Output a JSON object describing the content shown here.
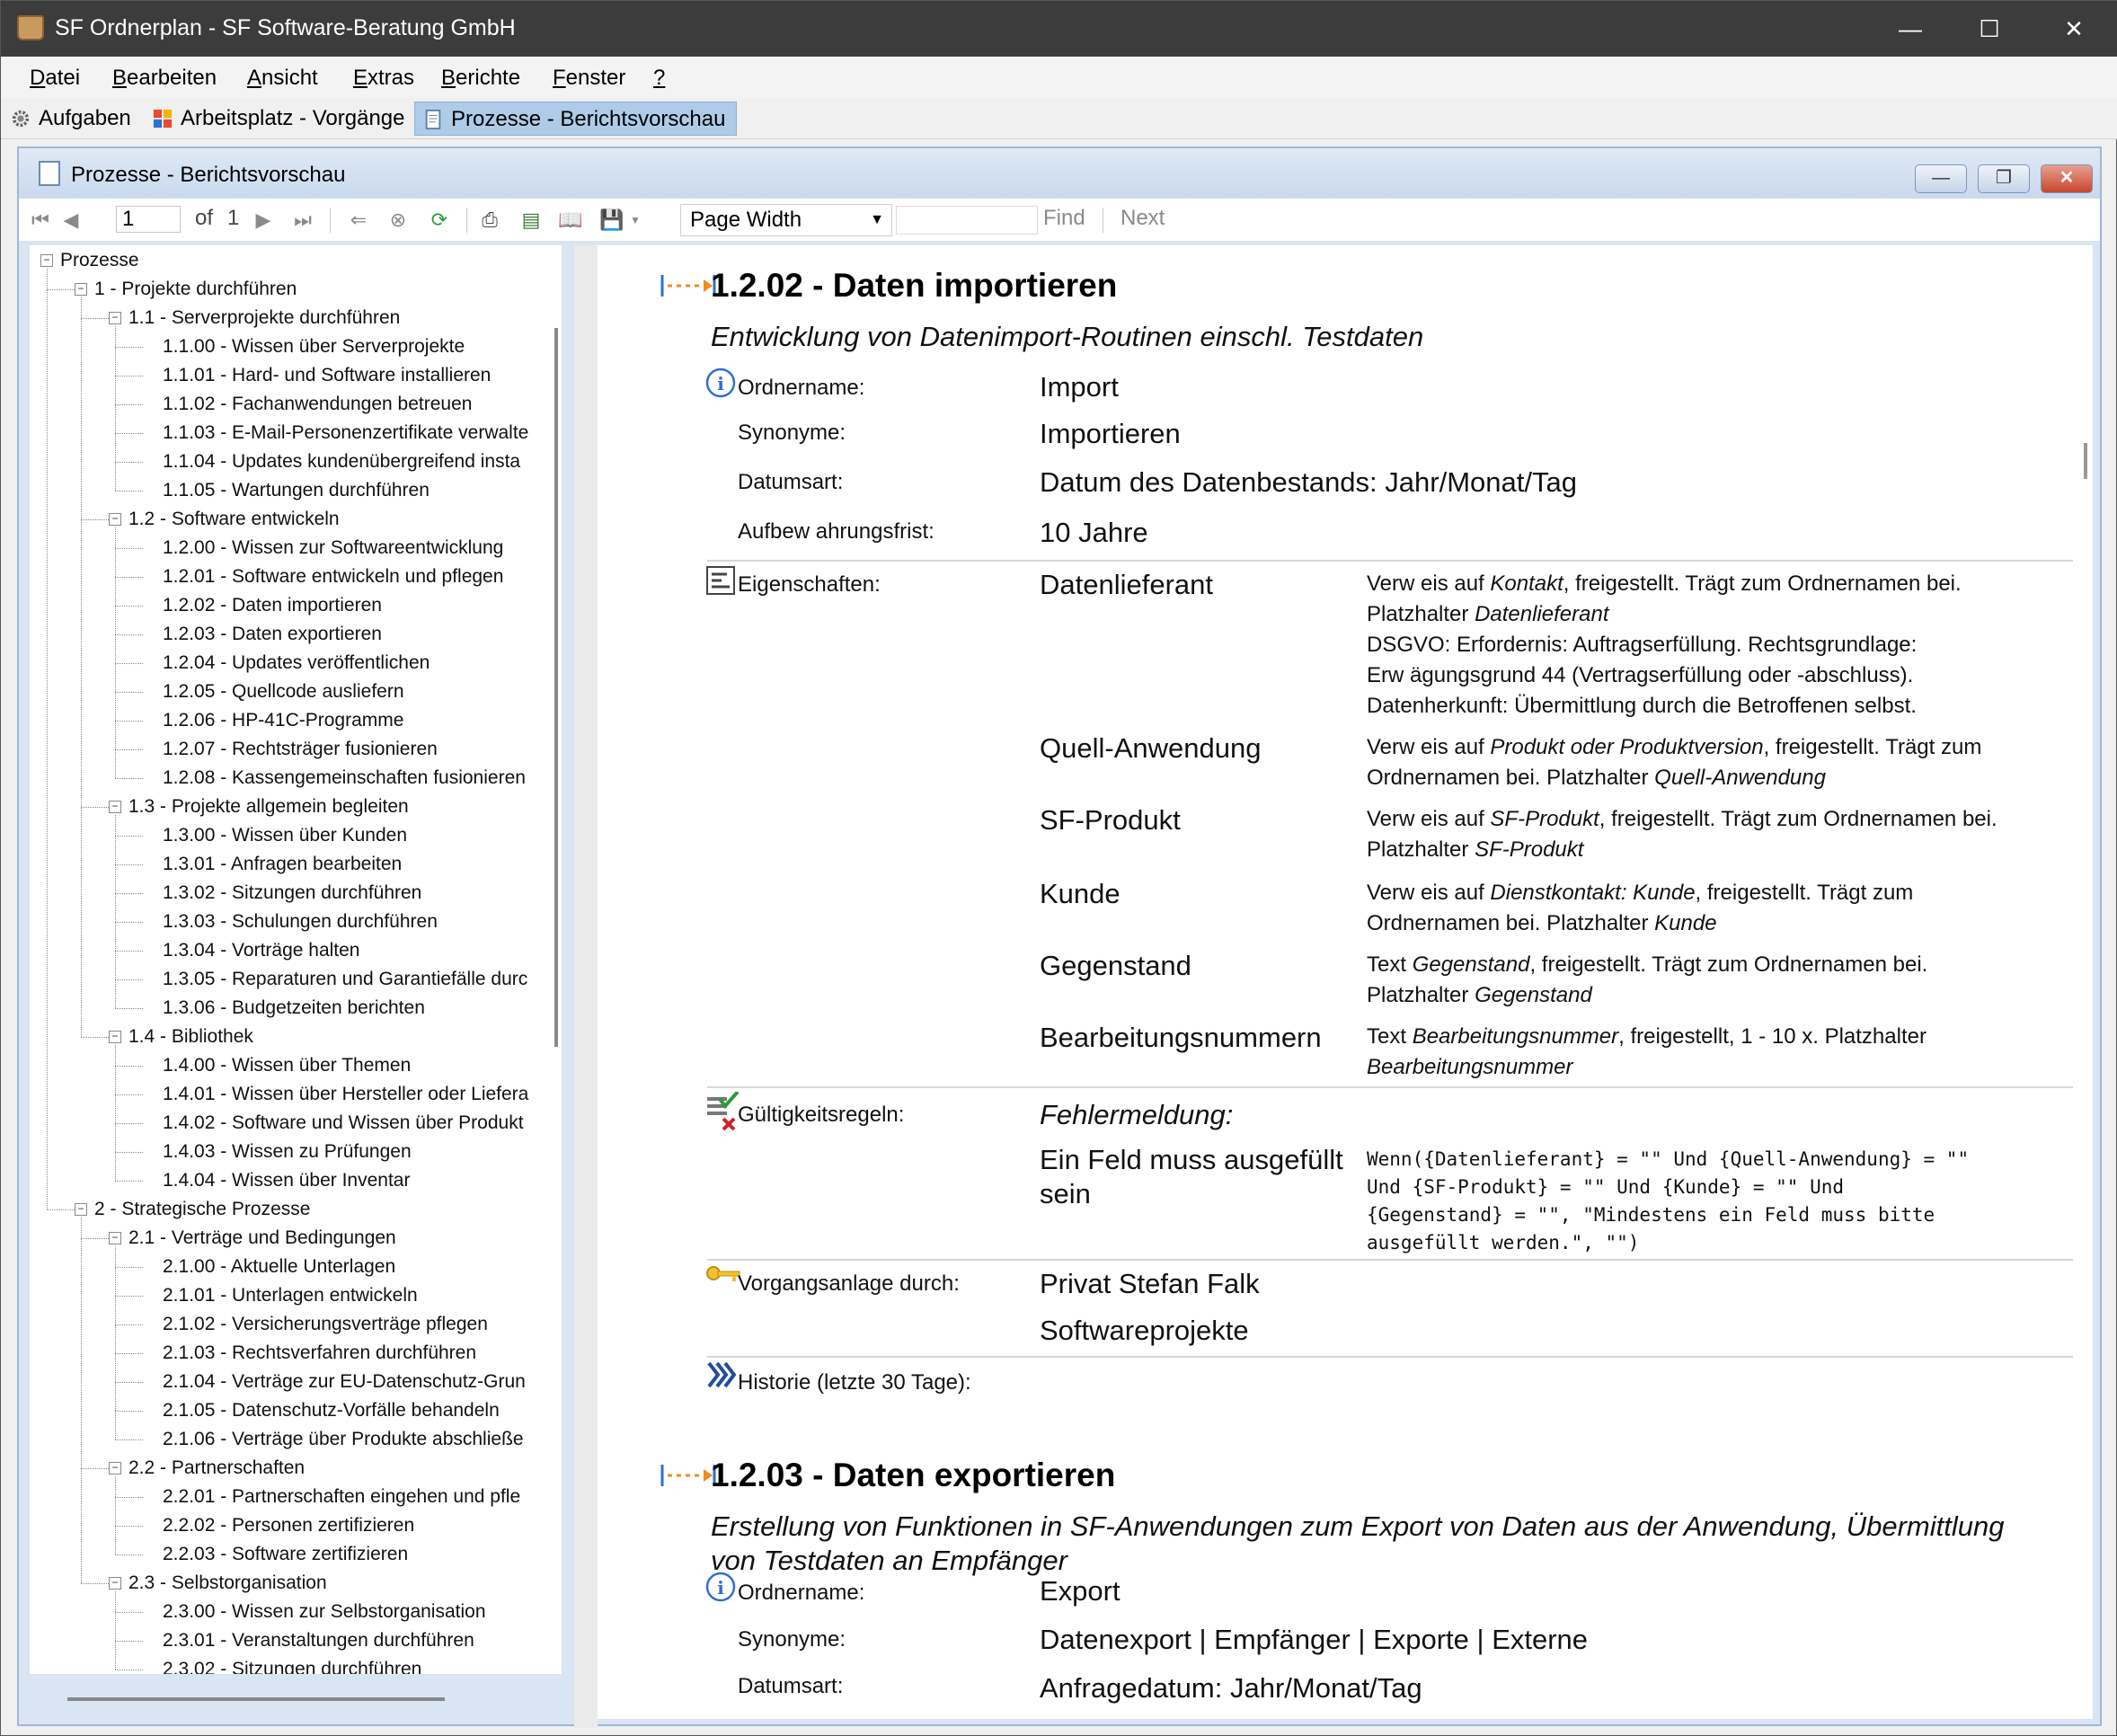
{
  "window": {
    "title": "SF Ordnerplan - SF Software-Beratung GmbH"
  },
  "menu": {
    "items": [
      "Datei",
      "Bearbeiten",
      "Ansicht",
      "Extras",
      "Berichte",
      "Fenster",
      "?"
    ]
  },
  "tabs": [
    {
      "label": "Aufgaben"
    },
    {
      "label": "Arbeitsplatz - Vorgänge"
    },
    {
      "label": "Prozesse - Berichtsvorschau"
    }
  ],
  "child_window": {
    "title": "Prozesse - Berichtsvorschau"
  },
  "report_toolbar": {
    "page_current": "1",
    "of_label": "of",
    "page_total": "1",
    "zoom": "Page Width",
    "find_label": "Find",
    "next_label": "Next"
  },
  "tree": {
    "nodes": [
      {
        "label": "Prozesse",
        "level": 0,
        "expandable": true
      },
      {
        "label": "1 - Projekte durchführen",
        "level": 1,
        "expandable": true
      },
      {
        "label": "1.1 - Serverprojekte durchführen",
        "level": 2,
        "expandable": true
      },
      {
        "label": "1.1.00 - Wissen über Serverprojekte",
        "level": 3
      },
      {
        "label": "1.1.01 - Hard- und Software installieren",
        "level": 3
      },
      {
        "label": "1.1.02 - Fachanwendungen betreuen",
        "level": 3
      },
      {
        "label": "1.1.03 - E-Mail-Personenzertifikate verwalte",
        "level": 3
      },
      {
        "label": "1.1.04 - Updates kundenübergreifend insta",
        "level": 3
      },
      {
        "label": "1.1.05 - Wartungen durchführen",
        "level": 3
      },
      {
        "label": "1.2 - Software entwickeln",
        "level": 2,
        "expandable": true
      },
      {
        "label": "1.2.00 - Wissen zur Softwareentwicklung",
        "level": 3
      },
      {
        "label": "1.2.01 - Software entwickeln und pflegen",
        "level": 3
      },
      {
        "label": "1.2.02 - Daten importieren",
        "level": 3
      },
      {
        "label": "1.2.03 - Daten exportieren",
        "level": 3
      },
      {
        "label": "1.2.04 - Updates veröffentlichen",
        "level": 3
      },
      {
        "label": "1.2.05 - Quellcode ausliefern",
        "level": 3
      },
      {
        "label": "1.2.06 - HP-41C-Programme",
        "level": 3
      },
      {
        "label": "1.2.07 - Rechtsträger fusionieren",
        "level": 3
      },
      {
        "label": "1.2.08 - Kassengemeinschaften fusionieren",
        "level": 3
      },
      {
        "label": "1.3 - Projekte allgemein begleiten",
        "level": 2,
        "expandable": true
      },
      {
        "label": "1.3.00 - Wissen über Kunden",
        "level": 3
      },
      {
        "label": "1.3.01 - Anfragen bearbeiten",
        "level": 3
      },
      {
        "label": "1.3.02 - Sitzungen durchführen",
        "level": 3
      },
      {
        "label": "1.3.03 - Schulungen durchführen",
        "level": 3
      },
      {
        "label": "1.3.04 - Vorträge halten",
        "level": 3
      },
      {
        "label": "1.3.05 - Reparaturen und Garantiefälle durc",
        "level": 3
      },
      {
        "label": "1.3.06 - Budgetzeiten berichten",
        "level": 3
      },
      {
        "label": "1.4 - Bibliothek",
        "level": 2,
        "expandable": true
      },
      {
        "label": "1.4.00 - Wissen über Themen",
        "level": 3
      },
      {
        "label": "1.4.01 - Wissen über Hersteller oder Liefera",
        "level": 3
      },
      {
        "label": "1.4.02 - Software und Wissen über Produkt",
        "level": 3
      },
      {
        "label": "1.4.03 - Wissen zu Prüfungen",
        "level": 3
      },
      {
        "label": "1.4.04 - Wissen über Inventar",
        "level": 3
      },
      {
        "label": "2 - Strategische Prozesse",
        "level": 1,
        "expandable": true
      },
      {
        "label": "2.1 - Verträge und Bedingungen",
        "level": 2,
        "expandable": true
      },
      {
        "label": "2.1.00 - Aktuelle Unterlagen",
        "level": 3
      },
      {
        "label": "2.1.01 - Unterlagen entwickeln",
        "level": 3
      },
      {
        "label": "2.1.02 - Versicherungsverträge pflegen",
        "level": 3
      },
      {
        "label": "2.1.03 - Rechtsverfahren durchführen",
        "level": 3
      },
      {
        "label": "2.1.04 - Verträge zur EU-Datenschutz-Grun",
        "level": 3
      },
      {
        "label": "2.1.05 - Datenschutz-Vorfälle behandeln",
        "level": 3
      },
      {
        "label": "2.1.06 - Verträge über Produkte abschließe",
        "level": 3
      },
      {
        "label": "2.2 - Partnerschaften",
        "level": 2,
        "expandable": true
      },
      {
        "label": "2.2.01 - Partnerschaften eingehen und pfle",
        "level": 3
      },
      {
        "label": "2.2.02 - Personen zertifizieren",
        "level": 3
      },
      {
        "label": "2.2.03 - Software zertifizieren",
        "level": 3
      },
      {
        "label": "2.3 - Selbstorganisation",
        "level": 2,
        "expandable": true
      },
      {
        "label": "2.3.00 - Wissen zur Selbstorganisation",
        "level": 3
      },
      {
        "label": "2.3.01 - Veranstaltungen durchführen",
        "level": 3
      },
      {
        "label": "2.3.02 - Sitzungen durchführen",
        "level": 3
      }
    ]
  },
  "report": {
    "section1": {
      "heading": "1.2.02 - Daten importieren",
      "subtitle": "Entwicklung von Datenimport-Routinen einschl. Testdaten",
      "ordnername_label": "Ordnername:",
      "ordnername": "Import",
      "synonyme_label": "Synonyme:",
      "synonyme": "Importieren",
      "datumsart_label": "Datumsart:",
      "datumsart": "Datum des Datenbestands: Jahr/Monat/Tag",
      "frist_label": "Aufbew ahrungsfrist:",
      "frist": "10 Jahre",
      "eigenschaften_label": "Eigenschaften:",
      "props": [
        {
          "name": "Datenlieferant",
          "d1": "Verw eis auf ",
          "d1i": "Kontakt",
          "d2": ", freigestellt. Trägt zum Ordnernamen bei.",
          "d3": "Platzhalter ",
          "d3i": "Datenlieferant",
          "extra": [
            "DSGVO: Erfordernis: Auftragserfüllung. Rechtsgrundlage:",
            "Erw ägungsgrund 44 (Vertragserfüllung oder -abschluss).",
            "Datenherkunft: Übermittlung durch die Betroffenen selbst."
          ]
        },
        {
          "name": "Quell-Anwendung",
          "d1": "Verw eis auf ",
          "d1i": "Produkt oder Produktversion",
          "d2": ", freigestellt. Trägt zum",
          "d3": "Ordnernamen bei. Platzhalter ",
          "d3i": "Quell-Anwendung"
        },
        {
          "name": "SF-Produkt",
          "d1": "Verw eis auf ",
          "d1i": "SF-Produkt",
          "d2": ", freigestellt. Trägt zum Ordnernamen bei.",
          "d3": "Platzhalter ",
          "d3i": "SF-Produkt"
        },
        {
          "name": "Kunde",
          "d1": "Verw eis auf ",
          "d1i": "Dienstkontakt: Kunde",
          "d2": ", freigestellt. Trägt zum",
          "d3": "Ordnernamen bei. Platzhalter ",
          "d3i": "Kunde"
        },
        {
          "name": "Gegenstand",
          "d1": "Text ",
          "d1i": "Gegenstand",
          "d2": ", freigestellt. Trägt zum Ordnernamen bei.",
          "d3": "Platzhalter ",
          "d3i": "Gegenstand"
        },
        {
          "name": "Bearbeitungsnummern",
          "d1": "Text ",
          "d1i": "Bearbeitungsnummer",
          "d2": ", freigestellt, 1 - 10 x. Platzhalter",
          "d3": "",
          "d3i": "Bearbeitungsnummer"
        }
      ],
      "gueltigkeit_label": "Gültigkeitsregeln:",
      "fehlermeldung": "Fehlermeldung:",
      "regel_name_1": "Ein Feld muss ausgefüllt",
      "regel_name_2": "sein",
      "regel_formel": "Wenn({Datenlieferant} = \"\" Und {Quell-Anwendung} = \"\"\nUnd {SF-Produkt} = \"\" Und {Kunde} = \"\" Und\n{Gegenstand} = \"\", \"Mindestens ein Feld muss bitte\nausgefüllt werden.\", \"\")",
      "vorgang_label": "Vorgangsanlage durch:",
      "vorgang_1": "Privat Stefan Falk",
      "vorgang_2": "Softwareprojekte",
      "historie_label": "Historie (letzte 30 Tage):"
    },
    "section2": {
      "heading": "1.2.03 - Daten exportieren",
      "subtitle_1": "Erstellung von Funktionen in SF-Anwendungen zum Export von Daten aus der Anwendung, Übermittlung",
      "subtitle_2": "von Testdaten an Empfänger",
      "ordnername_label": "Ordnername:",
      "ordnername": "Export",
      "synonyme_label": "Synonyme:",
      "synonyme": "Datenexport | Empfänger | Exporte | Externe",
      "datumsart_label": "Datumsart:",
      "datumsart": "Anfragedatum: Jahr/Monat/Tag"
    }
  }
}
